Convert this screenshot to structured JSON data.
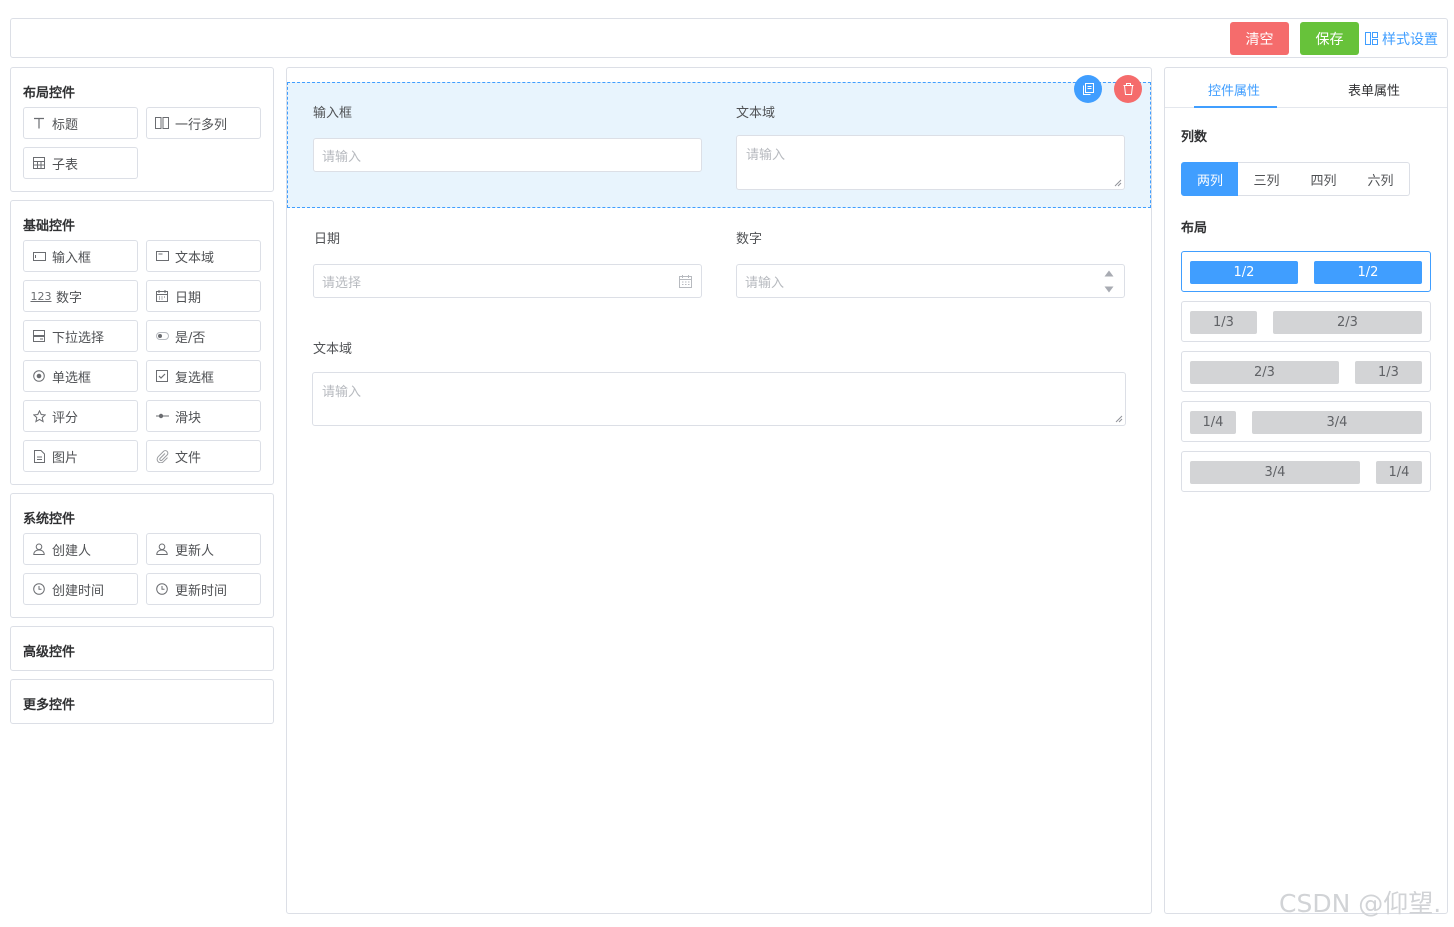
{
  "toolbar": {
    "clear_label": "清空",
    "save_label": "保存",
    "style_label": "样式设置"
  },
  "left_panel": {
    "layout_group": {
      "title": "布局控件",
      "items": [
        {
          "label": "标题",
          "icon": "text-t-icon"
        },
        {
          "label": "一行多列",
          "icon": "columns-icon"
        },
        {
          "label": "子表",
          "icon": "table-icon"
        }
      ]
    },
    "basic_group": {
      "title": "基础控件",
      "items": [
        {
          "label": "输入框",
          "icon": "input-icon"
        },
        {
          "label": "文本域",
          "icon": "textarea-icon"
        },
        {
          "label": "数字",
          "icon": "number-123-icon",
          "glyph": "123"
        },
        {
          "label": "日期",
          "icon": "calendar-icon"
        },
        {
          "label": "下拉选择",
          "icon": "dropdown-icon"
        },
        {
          "label": "是/否",
          "icon": "toggle-icon"
        },
        {
          "label": "单选框",
          "icon": "radio-icon"
        },
        {
          "label": "复选框",
          "icon": "checkbox-icon"
        },
        {
          "label": "评分",
          "icon": "star-icon"
        },
        {
          "label": "滑块",
          "icon": "slider-icon"
        },
        {
          "label": "图片",
          "icon": "image-file-icon"
        },
        {
          "label": "文件",
          "icon": "paperclip-icon"
        }
      ]
    },
    "system_group": {
      "title": "系统控件",
      "items": [
        {
          "label": "创建人",
          "icon": "user-icon"
        },
        {
          "label": "更新人",
          "icon": "user-icon"
        },
        {
          "label": "创建时间",
          "icon": "clock-icon"
        },
        {
          "label": "更新时间",
          "icon": "clock-icon"
        }
      ]
    },
    "advanced_group": {
      "title": "高级控件"
    },
    "more_group": {
      "title": "更多控件"
    }
  },
  "canvas": {
    "row1": {
      "field1": {
        "label": "输入框",
        "placeholder": "请输入"
      },
      "field2": {
        "label": "文本域",
        "placeholder": "请输入"
      }
    },
    "row2": {
      "field1": {
        "label": "日期",
        "placeholder": "请选择"
      },
      "field2": {
        "label": "数字",
        "placeholder": "请输入"
      }
    },
    "row3": {
      "field1": {
        "label": "文本域",
        "placeholder": "请输入"
      }
    }
  },
  "right_panel": {
    "tabs": [
      {
        "label": "控件属性",
        "active": true
      },
      {
        "label": "表单属性",
        "active": false
      }
    ],
    "columns_title": "列数",
    "column_options": [
      {
        "label": "两列",
        "active": true
      },
      {
        "label": "三列"
      },
      {
        "label": "四列"
      },
      {
        "label": "六列"
      }
    ],
    "layout_title": "布局",
    "layout_options": [
      {
        "cells": [
          "1/2",
          "1/2"
        ],
        "active": true
      },
      {
        "cells": [
          "1/3",
          "2/3"
        ]
      },
      {
        "cells": [
          "2/3",
          "1/3"
        ]
      },
      {
        "cells": [
          "1/4",
          "3/4"
        ]
      },
      {
        "cells": [
          "3/4",
          "1/4"
        ]
      }
    ]
  },
  "watermark": "CSDN @仰望.",
  "colors": {
    "primary": "#409eff",
    "danger": "#f56c6c",
    "success": "#67c23a",
    "border": "#dcdfe6",
    "selected_bg": "#e8f4fd"
  }
}
